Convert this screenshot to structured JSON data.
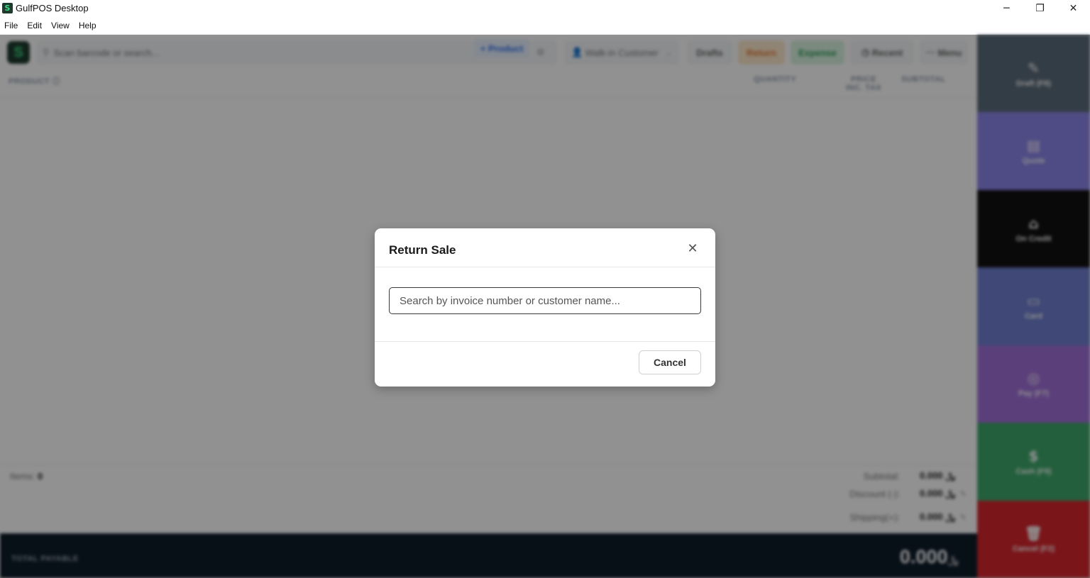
{
  "window": {
    "title": "GulfPOS Desktop",
    "app_icon_glyph": "S",
    "minimize_glyph": "─",
    "maximize_glyph": "❐",
    "close_glyph": "✕"
  },
  "menubar": {
    "items": [
      "File",
      "Edit",
      "View",
      "Help"
    ]
  },
  "topbar": {
    "logo_glyph": "S",
    "search_placeholder": "Scan barcode or search...",
    "add_product_label": "+ Product",
    "customer_label": "Walk-in Customer",
    "drafts_label": "Drafts",
    "return_label": "Return",
    "expense_label": "Expense",
    "recent_label": "Recent",
    "menu_label": "Menu"
  },
  "table": {
    "columns": [
      "PRODUCT ⓘ",
      "QUANTITY",
      "PRICE INC. TAX",
      "SUBTOTAL"
    ]
  },
  "summary": {
    "items_label": "Items:",
    "items_count": "0",
    "subtotal_label": "Subtotal:",
    "subtotal_value": "0.000",
    "discount_label": "Discount (-):",
    "discount_value": "0.000",
    "shipping_label": "Shipping(+):",
    "shipping_value": "0.000",
    "currency_glyph": "﷼",
    "total_label": "TOTAL PAYABLE",
    "total_value": "0.000"
  },
  "actions": [
    {
      "label": "Draft (F8)",
      "icon": "✎",
      "color": "#5b6b7b"
    },
    {
      "label": "Quote",
      "icon": "▤",
      "color": "#8c84e8"
    },
    {
      "label": "On Credit",
      "icon": "⌂",
      "color": "#111111"
    },
    {
      "label": "Card",
      "icon": "▭",
      "color": "#6f7fcf"
    },
    {
      "label": "Pay (F7)",
      "icon": "◎",
      "color": "#a070d8"
    },
    {
      "label": "Cash (F9)",
      "icon": "$",
      "color": "#3fa86b"
    },
    {
      "label": "Cancel (F2)",
      "icon": "🗑",
      "color": "#d7262e"
    }
  ],
  "modal": {
    "title": "Return Sale",
    "close_glyph": "✕",
    "search_placeholder": "Search by invoice number or customer name...",
    "search_value": "",
    "cancel_label": "Cancel"
  }
}
